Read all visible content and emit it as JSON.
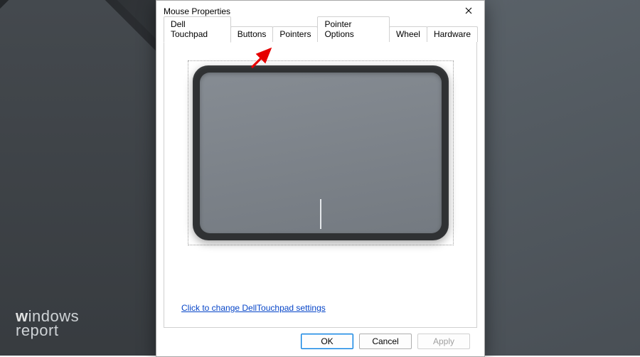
{
  "watermark": {
    "line1_bold": "w",
    "line1_rest": "indows",
    "line2": "report"
  },
  "dialog": {
    "title": "Mouse Properties",
    "tabs": [
      {
        "label": "Dell Touchpad",
        "active": true
      },
      {
        "label": "Buttons",
        "active": false
      },
      {
        "label": "Pointers",
        "active": false
      },
      {
        "label": "Pointer Options",
        "active": false
      },
      {
        "label": "Wheel",
        "active": false
      },
      {
        "label": "Hardware",
        "active": false
      }
    ],
    "link_text": "Click to change DellTouchpad settings",
    "buttons": {
      "ok": "OK",
      "cancel": "Cancel",
      "apply": "Apply"
    }
  }
}
